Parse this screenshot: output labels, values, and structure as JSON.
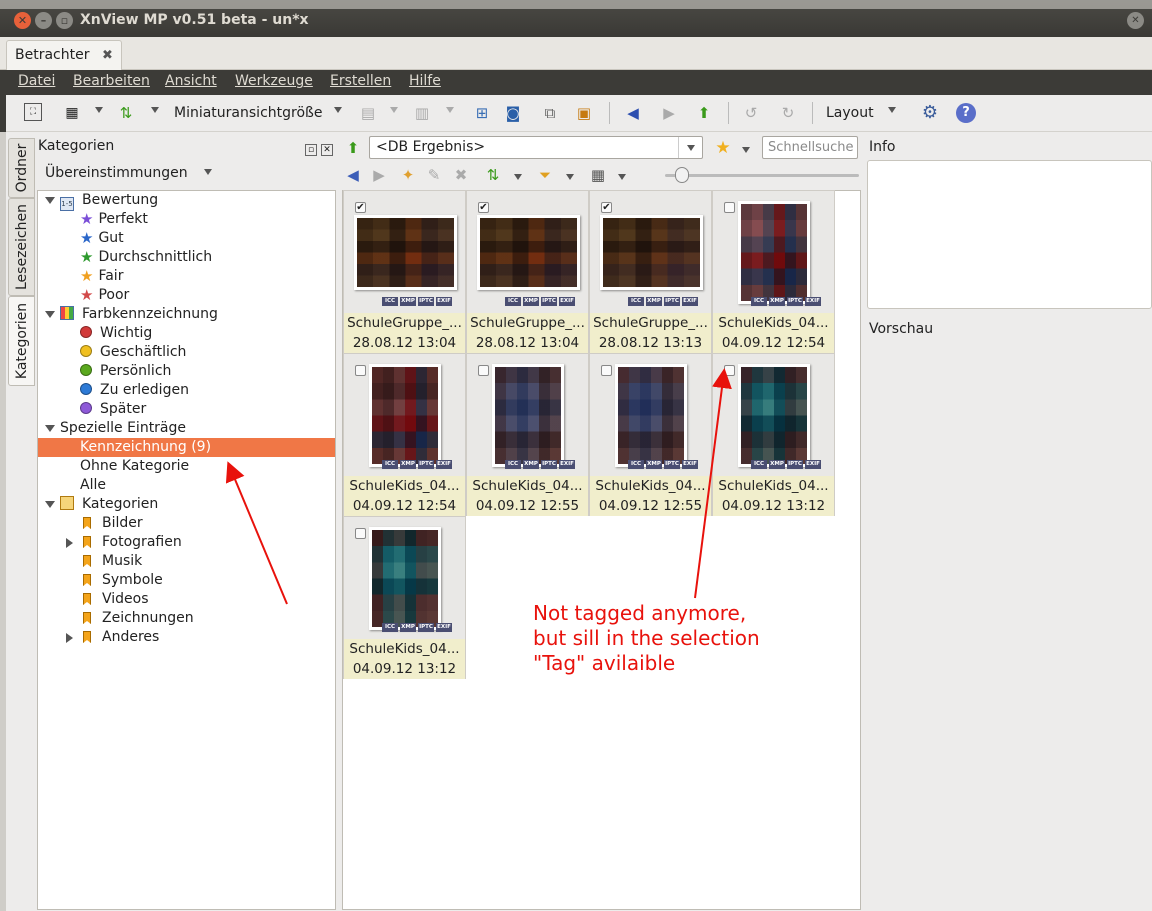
{
  "window": {
    "title": "XnView MP v0.51 beta - un*x",
    "background_url_fragment": "www.fr-online.de/politik/1472596,1472596.html"
  },
  "tab": {
    "label": "Betrachter",
    "close": "✖"
  },
  "menu": [
    "Datei",
    "Bearbeiten",
    "Ansicht",
    "Werkzeuge",
    "Erstellen",
    "Hilfe"
  ],
  "toolbar": {
    "thumb_size": "Miniaturansichtgröße",
    "layout": "Layout"
  },
  "vertical_tabs": [
    "Ordner",
    "Lesezeichen",
    "Kategorien"
  ],
  "left_panel": {
    "title": "Kategorien",
    "match_label": "Übereinstimmungen",
    "tree": {
      "rating": {
        "label": "Bewertung",
        "items": [
          "Perfekt",
          "Gut",
          "Durchschnittlich",
          "Fair",
          "Poor"
        ]
      },
      "color": {
        "label": "Farbkennzeichnung",
        "items": [
          "Wichtig",
          "Geschäftlich",
          "Persönlich",
          "Zu erledigen",
          "Später"
        ]
      },
      "special": {
        "label": "Spezielle Einträge",
        "items": [
          "Kennzeichnung (9)",
          "Ohne Kategorie",
          "Alle"
        ]
      },
      "categories": {
        "label": "Kategorien",
        "items": [
          "Bilder",
          "Fotografien",
          "Musik",
          "Symbole",
          "Videos",
          "Zeichnungen",
          "Anderes"
        ]
      }
    }
  },
  "address": "<DB Ergebnis>",
  "search_placeholder": "Schnellsuche",
  "thumb_tags": [
    "ICC",
    "XMP",
    "IPTC",
    "EXIF"
  ],
  "thumbnails": [
    {
      "name": "SchuleGruppe_...",
      "date": "28.08.12 13:04",
      "checked": true
    },
    {
      "name": "SchuleGruppe_...",
      "date": "28.08.12 13:04",
      "checked": true
    },
    {
      "name": "SchuleGruppe_...",
      "date": "28.08.12 13:13",
      "checked": true
    },
    {
      "name": "SchuleKids_04...",
      "date": "04.09.12 12:54",
      "checked": false
    },
    {
      "name": "SchuleKids_04...",
      "date": "04.09.12 12:54",
      "checked": false
    },
    {
      "name": "SchuleKids_04...",
      "date": "04.09.12 12:55",
      "checked": false
    },
    {
      "name": "SchuleKids_04...",
      "date": "04.09.12 12:55",
      "checked": false
    },
    {
      "name": "SchuleKids_04...",
      "date": "04.09.12 13:12",
      "checked": false
    },
    {
      "name": "SchuleKids_04...",
      "date": "04.09.12 13:12",
      "checked": false
    }
  ],
  "right_panel": {
    "info": "Info",
    "preview": "Vorschau"
  },
  "annotation": [
    "Not tagged anymore,",
    "but sill in the selection",
    "\"Tag\" avilaible"
  ]
}
